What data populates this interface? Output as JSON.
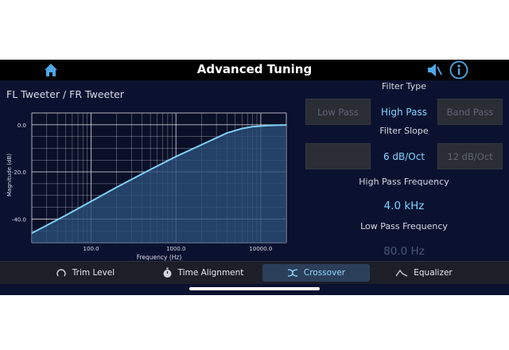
{
  "header": {
    "title": "Advanced Tuning",
    "home_icon": "home-icon",
    "speaker_icon": "speaker-icon",
    "info_icon": "info-icon"
  },
  "chart_title": "FL Tweeter / FR Tweeter",
  "chart_data": {
    "type": "line",
    "title": "FL Tweeter / FR Tweeter",
    "xlabel": "Frequency (Hz)",
    "ylabel": "Magnitude (dB)",
    "x_scale": "log",
    "xlim": [
      20,
      20000
    ],
    "ylim": [
      -50,
      5
    ],
    "x_ticks": [
      100,
      1000,
      10000
    ],
    "x_tick_labels": [
      "100.0",
      "1000.0",
      "10000.0"
    ],
    "y_ticks": [
      0,
      -20,
      -40
    ],
    "y_tick_labels": [
      "0.0",
      "-20.0",
      "-40.0"
    ],
    "grid": true,
    "fill": "area below curve",
    "series": [
      {
        "x": [
          20,
          50,
          100,
          200,
          500,
          1000,
          2000,
          4000,
          6000,
          8000,
          12000,
          20000
        ],
        "y": [
          -46,
          -38.5,
          -32.5,
          -26.5,
          -19,
          -13.5,
          -8.5,
          -3.5,
          -1.6,
          -0.8,
          -0.3,
          -0.1
        ]
      }
    ],
    "colors": {
      "line": "#7fd0f5",
      "fill": "#2a4d78",
      "grid": "#ffffff"
    }
  },
  "filter": {
    "type_label": "Filter Type",
    "types": [
      "Low Pass",
      "High Pass",
      "Band Pass"
    ],
    "selected_type": "High Pass",
    "slope_label": "Filter Slope",
    "slopes": [
      "",
      "6 dB/Oct",
      "12 dB/Oct"
    ],
    "selected_slope": "6 dB/Oct",
    "hp_freq_label": "High Pass Frequency",
    "hp_freq_value": "4.0 kHz",
    "lp_freq_label": "Low Pass Frequency",
    "lp_freq_value": "80.0 Hz"
  },
  "tabs": [
    {
      "label": "Trim Level",
      "icon": "trim-level-icon"
    },
    {
      "label": "Time Alignment",
      "icon": "stopwatch-icon"
    },
    {
      "label": "Crossover",
      "icon": "crossover-icon",
      "active": true
    },
    {
      "label": "Equalizer",
      "icon": "equalizer-icon"
    }
  ],
  "colors": {
    "background": "#0b1230",
    "accent": "#7ed4ff",
    "topbar": "#000000",
    "tabbar": "#1c1f27",
    "header_icon": "#4fa8e6"
  }
}
